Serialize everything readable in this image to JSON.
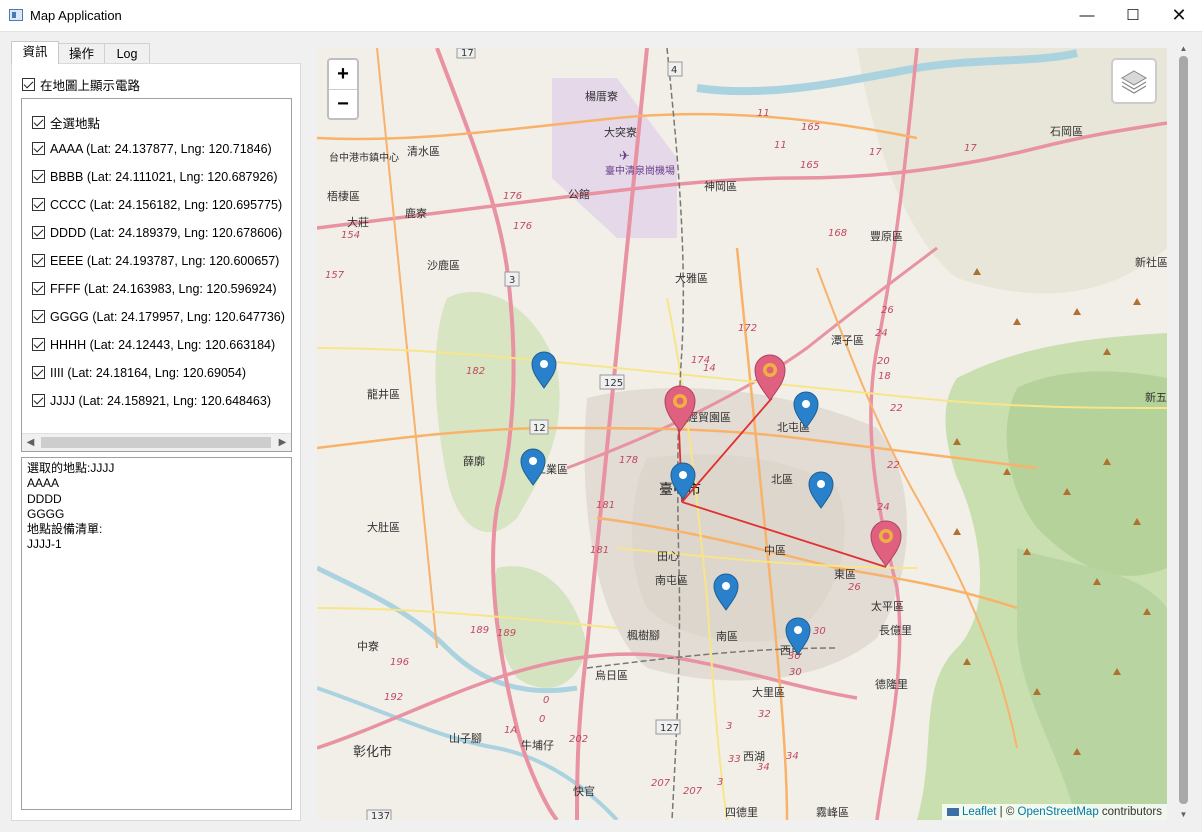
{
  "window": {
    "title": "Map Application",
    "minimize": "—",
    "maximize": "☐",
    "close": "✕"
  },
  "tabs": [
    {
      "label": "資訊"
    },
    {
      "label": "操作"
    },
    {
      "label": "Log"
    }
  ],
  "options": {
    "show_route_label": "在地圖上顯示電路"
  },
  "locations": {
    "select_all": "全選地點",
    "items": [
      {
        "label": "AAAA (Lat: 24.137877, Lng: 120.71846)"
      },
      {
        "label": "BBBB (Lat: 24.111021, Lng: 120.687926)"
      },
      {
        "label": "CCCC (Lat: 24.156182, Lng: 120.695775)"
      },
      {
        "label": "DDDD (Lat: 24.189379, Lng: 120.678606)"
      },
      {
        "label": "EEEE (Lat: 24.193787, Lng: 120.600657)"
      },
      {
        "label": "FFFF (Lat: 24.163983, Lng: 120.596924)"
      },
      {
        "label": "GGGG (Lat: 24.179957, Lng: 120.647736)"
      },
      {
        "label": "HHHH (Lat: 24.12443, Lng: 120.663184)"
      },
      {
        "label": "IIII (Lat: 24.18164, Lng: 120.69054)"
      },
      {
        "label": "JJJJ (Lat: 24.158921, Lng: 120.648463)"
      }
    ]
  },
  "info": {
    "lines": [
      "選取的地點:JJJJ",
      "AAAA",
      "DDDD",
      "GGGG",
      "地點設備清單:",
      "JJJJ-1"
    ]
  },
  "map": {
    "zoom_in": "+",
    "zoom_out": "−",
    "attribution_leaflet": "Leaflet",
    "attribution_sep": " | © ",
    "attribution_osm": "OpenStreetMap",
    "attribution_tail": " contributors",
    "labels": {
      "l1": "楊厝寮",
      "l2": "大突寮",
      "l3": "臺中清泉崗機場",
      "l4": "神岡區",
      "l5": "清水區",
      "l6": "台中港市鎮中心",
      "l7": "梧棲區",
      "l8": "鹿寮",
      "l9": "大莊",
      "l10": "沙鹿區",
      "l11": "公館",
      "l12": "大雅區",
      "l13": "豐原區",
      "l14": "石岡區",
      "l15": "新社區",
      "l16": "潭子區",
      "l17": "北屯區",
      "l18": "龍井區",
      "l19": "北區",
      "l20": "臺中市",
      "l21": "薛廓",
      "l22": "大肚區",
      "l23": "中區",
      "l24": "南屯區",
      "l25": "東區",
      "l26": "太平區",
      "l27": "長億里",
      "l28": "楓樹腳",
      "l29": "南區",
      "l30": "西屯",
      "l31": "烏日區",
      "l32": "大里區",
      "l33": "德隆里",
      "l34": "中寮",
      "l35": "彰化市",
      "l36": "山子腳",
      "l37": "牛埔仔",
      "l38": "西湖",
      "l39": "快官",
      "l40": "四德里",
      "l41": "霧峰區",
      "l42": "新五",
      "l43": "經貿園區",
      "l44": "田心",
      "l45": "工業區",
      "l46": "大雅"
    }
  },
  "colors": {
    "route": "#e03030",
    "blue_marker": "#2a81cb",
    "pink_marker": "#e06080"
  }
}
